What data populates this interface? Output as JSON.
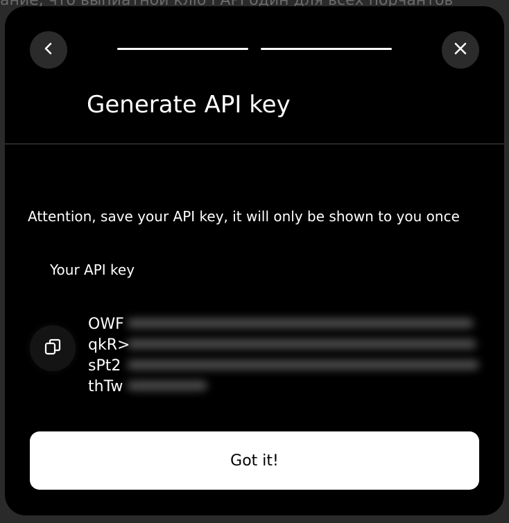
{
  "background": {
    "text": "ание, что выпиатной кліо і АРГодин для всех порчантов"
  },
  "dialog": {
    "title": "Generate API key",
    "attention": "Attention, save your API key, it will only be shown to you once",
    "key_label": "Your API key",
    "key_visible_lines": [
      "OWF",
      "qkR>",
      "sPt2",
      "thTw"
    ],
    "confirm_label": "Got it!",
    "progress": {
      "total_steps": 2,
      "completed_steps": 2
    },
    "icons": {
      "back": "chevron-left-icon",
      "close": "close-icon",
      "copy": "copy-icon"
    }
  },
  "colors": {
    "modal_bg": "#000000",
    "button_bg": "#ffffff",
    "round_btn_bg": "#2b2b2b"
  }
}
